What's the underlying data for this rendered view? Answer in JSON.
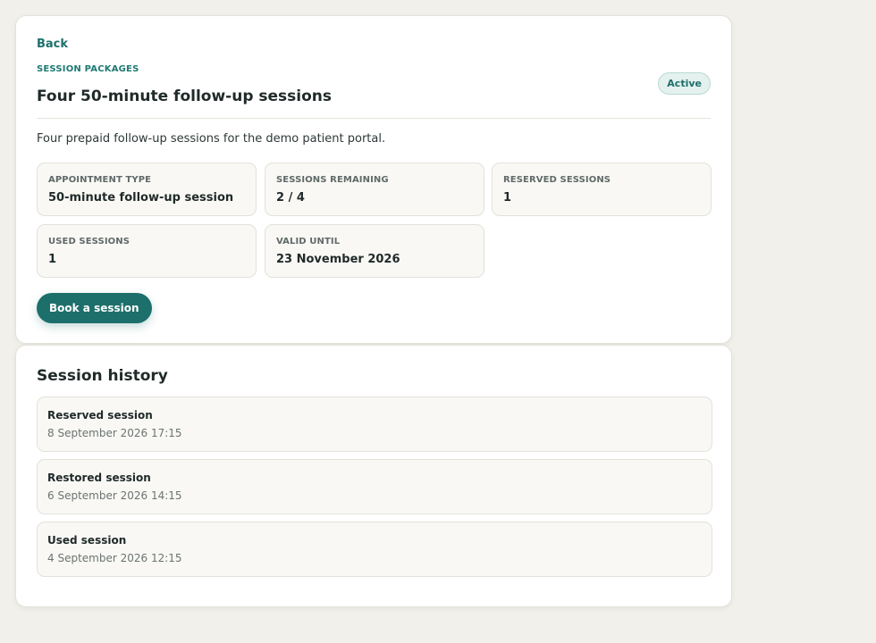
{
  "package": {
    "back_label": "Back",
    "eyebrow": "SESSION PACKAGES",
    "title": "Four 50-minute follow-up sessions",
    "status": "Active",
    "description": "Four prepaid follow-up sessions for the demo patient portal.",
    "stats": [
      {
        "label": "APPOINTMENT TYPE",
        "value": "50-minute follow-up session"
      },
      {
        "label": "SESSIONS REMAINING",
        "value": "2 / 4"
      },
      {
        "label": "RESERVED SESSIONS",
        "value": "1"
      },
      {
        "label": "USED SESSIONS",
        "value": "1"
      },
      {
        "label": "VALID UNTIL",
        "value": "23 November 2026"
      }
    ],
    "book_label": "Book a session"
  },
  "history": {
    "title": "Session history",
    "items": [
      {
        "title": "Reserved session",
        "date": "8 September 2026 17:15"
      },
      {
        "title": "Restored session",
        "date": "6 September 2026 14:15"
      },
      {
        "title": "Used session",
        "date": "4 September 2026 12:15"
      }
    ]
  },
  "colors": {
    "accent": "#1d6f6b",
    "background": "#f1f0eb",
    "card": "#ffffff",
    "badge_bg": "#e4f1ee"
  }
}
